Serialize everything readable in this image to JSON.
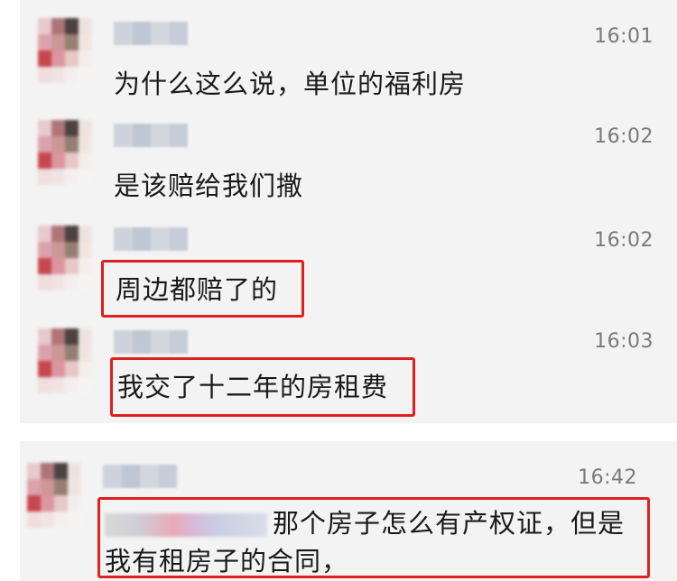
{
  "colors": {
    "panel_bg": "#f3f3f3",
    "highlight": "#e02020",
    "time_text": "#7a7a7a",
    "message_text": "#1a1a1a"
  },
  "messages": [
    {
      "time": "16:01",
      "text": "为什么这么说，单位的福利房",
      "highlighted": false
    },
    {
      "time": "16:02",
      "text": "是该赔给我们撒",
      "highlighted": false
    },
    {
      "time": "16:02",
      "text": "周边都赔了的",
      "highlighted": true
    },
    {
      "time": "16:03",
      "text": "我交了十二年的房租费",
      "highlighted": true
    }
  ],
  "bottom_message": {
    "time": "16:42",
    "line1": "那个房子怎么有产权证，但是",
    "line2": "我有租房子的合同，",
    "highlighted": true
  }
}
